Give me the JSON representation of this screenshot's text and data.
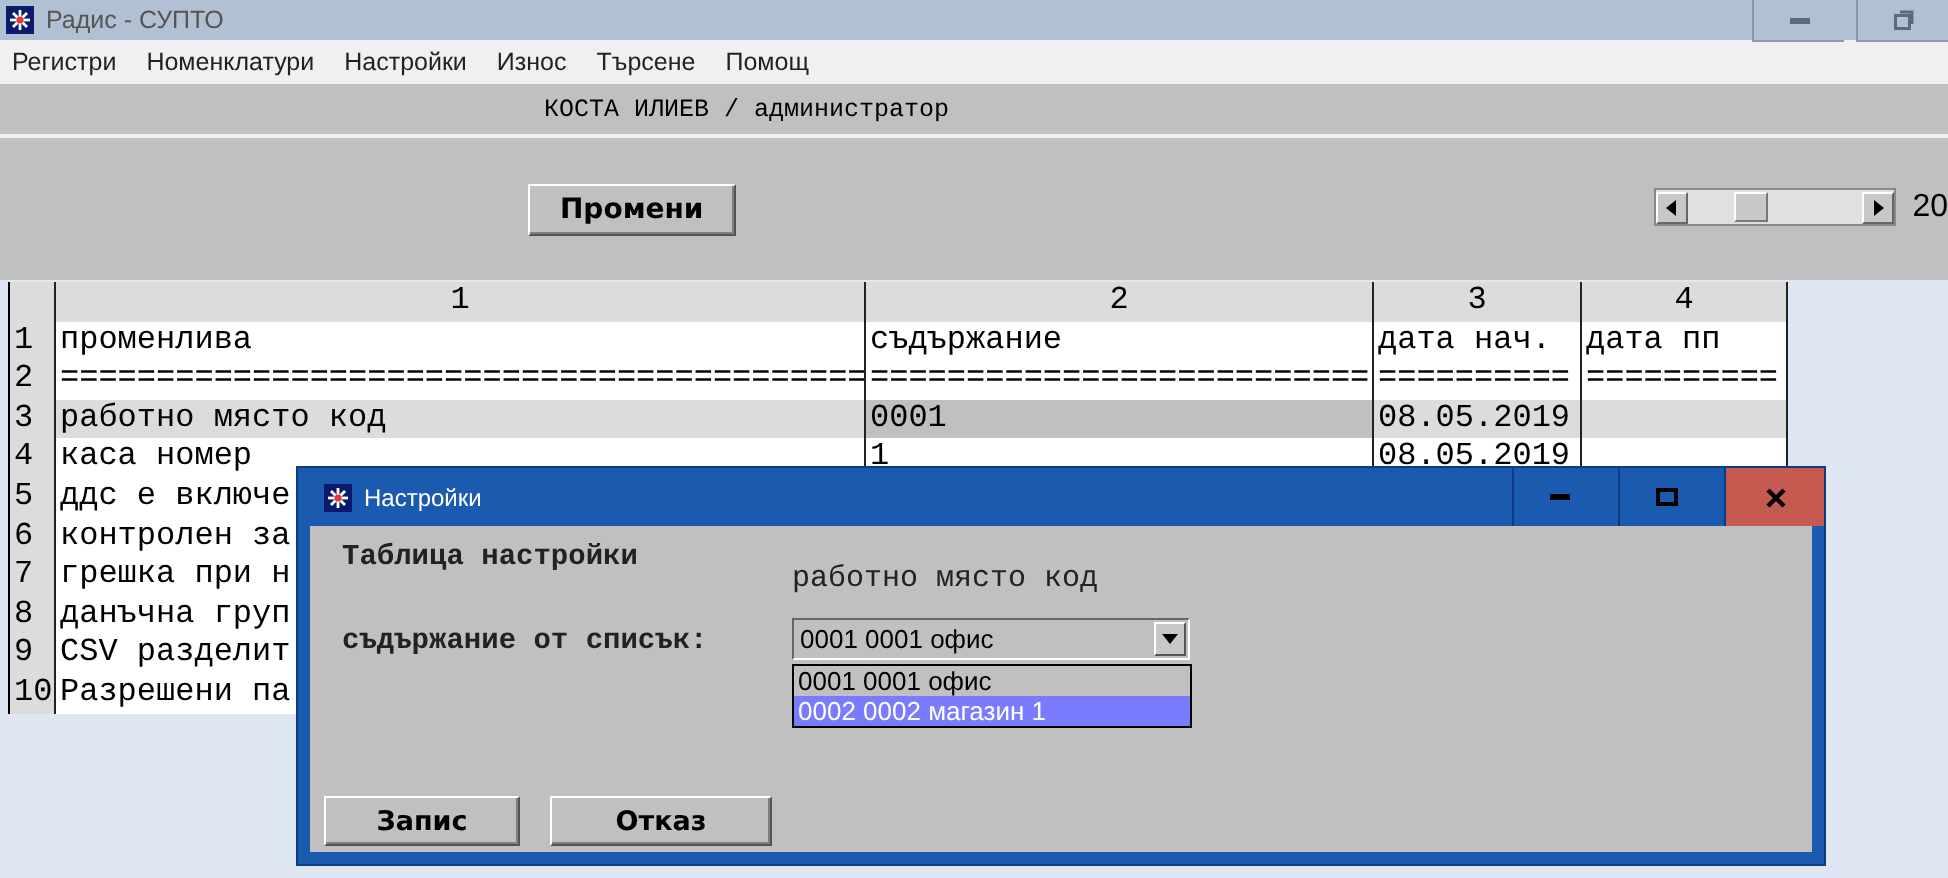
{
  "window": {
    "title": "Радис - СУПТО"
  },
  "menu": [
    "Регистри",
    "Номенклатури",
    "Настройки",
    "Износ",
    "Търсене",
    "Помощ"
  ],
  "user": "КОСТА ИЛИЕВ / администратор",
  "toolbar": {
    "button": "Промени",
    "scroll_label": "20"
  },
  "table": {
    "columns": [
      "1",
      "2",
      "3",
      "4"
    ],
    "rows": [
      {
        "number": "1",
        "selected": false,
        "cells": [
          "променлива",
          "съдържание",
          "дата нач.",
          "дата пп"
        ]
      },
      {
        "number": "2",
        "selected": false,
        "cells": [
          "==========================================",
          "==========================",
          "==========",
          "=========="
        ]
      },
      {
        "number": "3",
        "selected": true,
        "cells": [
          "работно място код",
          "0001",
          "08.05.2019",
          ""
        ]
      },
      {
        "number": "4",
        "selected": false,
        "cells": [
          "каса номер",
          "1",
          "08.05.2019",
          ""
        ]
      },
      {
        "number": "5",
        "selected": false,
        "cells": [
          "ддс е включе"
        ]
      },
      {
        "number": "6",
        "selected": false,
        "cells": [
          "контролен за"
        ]
      },
      {
        "number": "7",
        "selected": false,
        "cells": [
          "грешка при н"
        ]
      },
      {
        "number": "8",
        "selected": false,
        "cells": [
          "данъчна груп"
        ]
      },
      {
        "number": "9",
        "selected": false,
        "cells": [
          "CSV разделит"
        ]
      },
      {
        "number": "10",
        "selected": false,
        "cells": [
          "Разрешени па"
        ]
      }
    ]
  },
  "dialog": {
    "title": "Настройки",
    "table_label": "Таблица настройки",
    "table_value": "работно място код",
    "list_label": "съдържание от списък:",
    "combo_value": "0001 0001 офис",
    "options": [
      {
        "label": "0001 0001 офис",
        "selected": false
      },
      {
        "label": "0002 0002 магазин 1",
        "selected": true
      }
    ],
    "buttons": [
      "Запис",
      "Отказ"
    ]
  }
}
